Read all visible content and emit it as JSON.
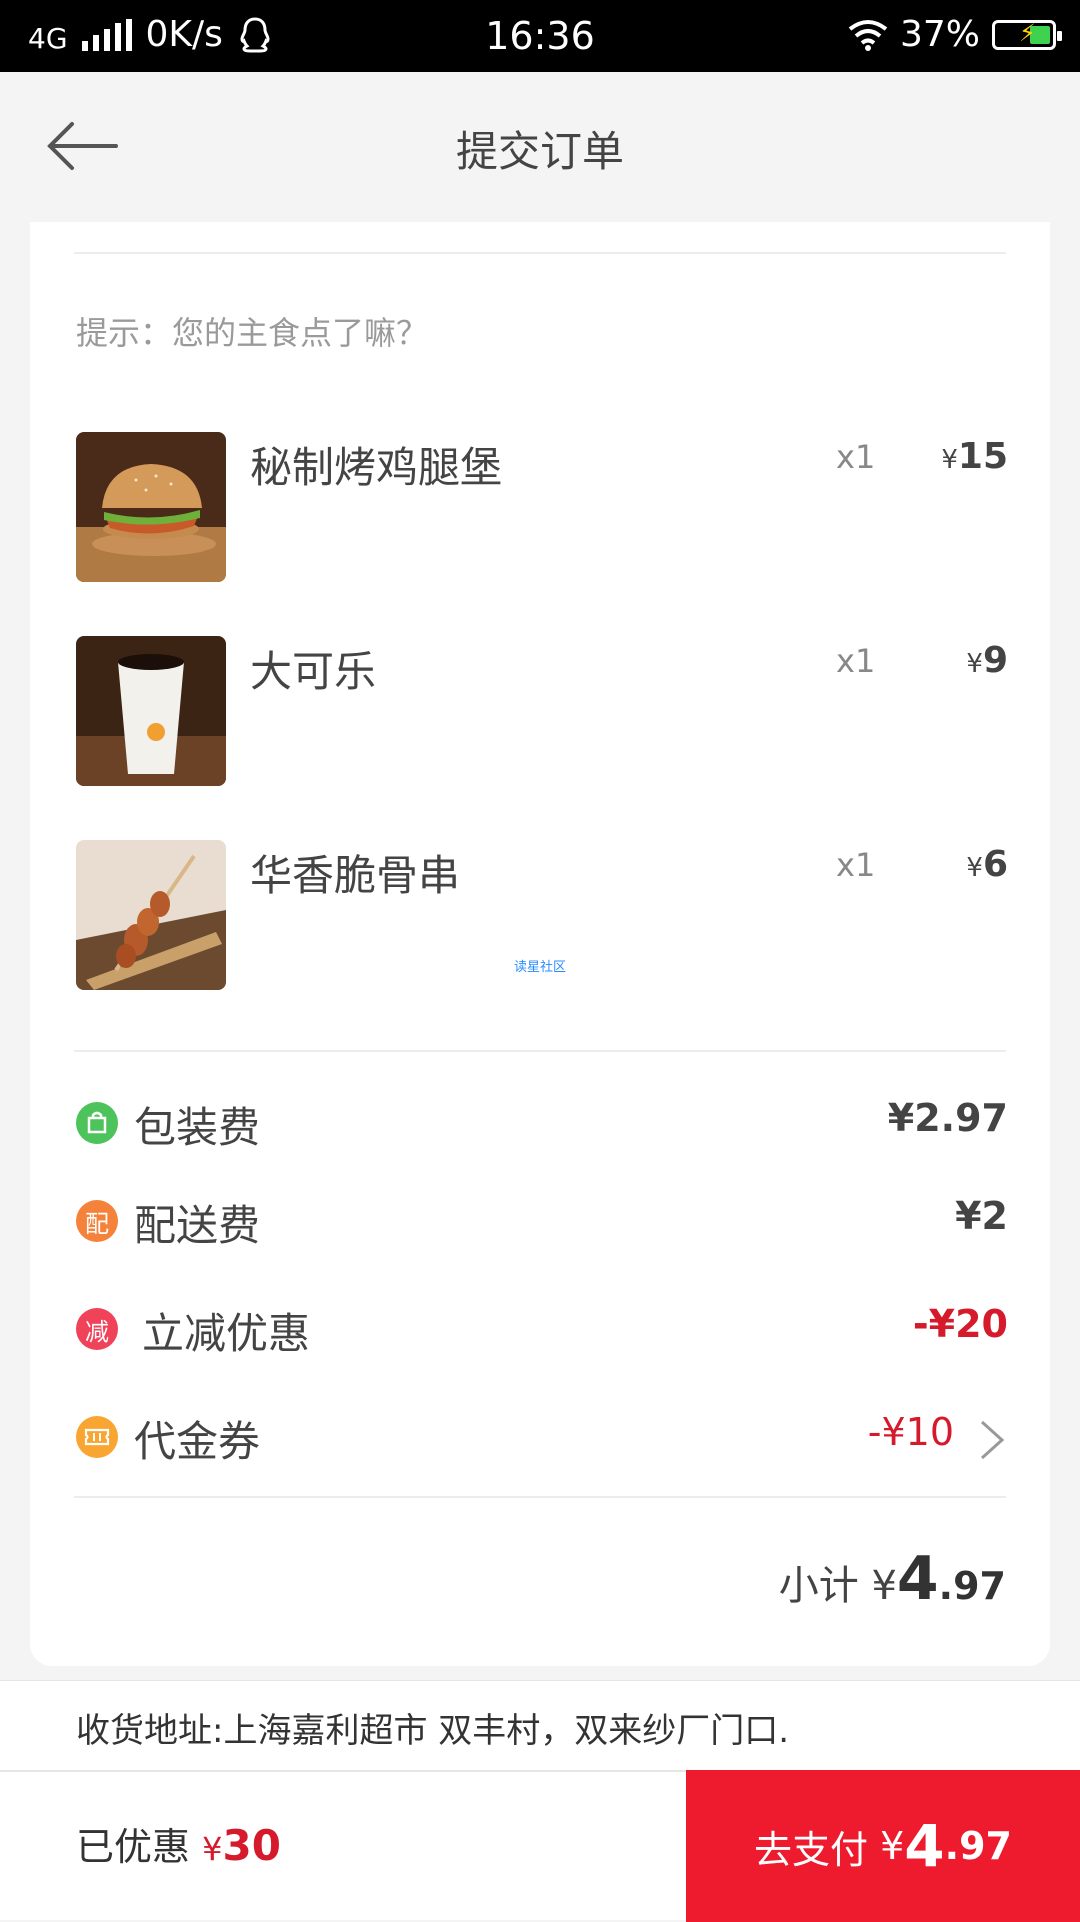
{
  "status_bar": {
    "network": "4G",
    "speed": "0K/s",
    "time": "16:36",
    "battery": "37%"
  },
  "header": {
    "title": "提交订单"
  },
  "hint": "提示：您的主食点了嘛？",
  "items": [
    {
      "name": "秘制烤鸡腿堡",
      "qty": "x1",
      "currency": "¥",
      "price": "15"
    },
    {
      "name": "大可乐",
      "qty": "x1",
      "currency": "¥",
      "price": "9"
    },
    {
      "name": "华香脆骨串",
      "qty": "x1",
      "currency": "¥",
      "price": "6"
    }
  ],
  "watermark": "读星社区",
  "fees": [
    {
      "icon": "bag-icon",
      "icon_text": "",
      "label": "包装费",
      "amount": "¥2.97",
      "color": "#4cc35b"
    },
    {
      "icon": "delivery-icon",
      "icon_text": "配",
      "label": "配送费",
      "amount": "¥2",
      "color": "#f5823a"
    },
    {
      "icon": "discount-icon",
      "icon_text": "减",
      "label": "立减优惠",
      "amount": "-¥20",
      "color": "#f0435a"
    },
    {
      "icon": "voucher-icon",
      "icon_text": "",
      "label": "代金券",
      "amount": "-¥10",
      "color": "#f9a532"
    }
  ],
  "subtotal": {
    "label": "小计",
    "currency": "¥",
    "int": "4",
    "dec": ".97"
  },
  "address": "收货地址:上海嘉利超市 双丰村，双来纱厂门口.",
  "bottom": {
    "saved_label": "已优惠",
    "saved_currency": "¥",
    "saved_value": "30",
    "pay_label": "去支付",
    "pay_currency": "¥",
    "pay_int": "4",
    "pay_dec": ".97"
  },
  "colors": {
    "accent_red": "#ee1a2d",
    "discount_red": "#d51a2c"
  }
}
